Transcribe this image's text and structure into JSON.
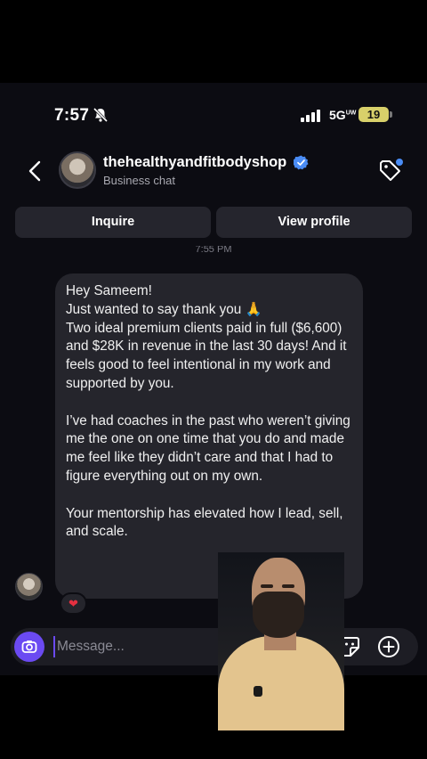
{
  "status_bar": {
    "time": "7:57",
    "network": "5G",
    "network_sup": "UW",
    "battery": "19"
  },
  "header": {
    "username": "thehealthyandfitbodyshop",
    "subtitle": "Business chat"
  },
  "actions": {
    "inquire": "Inquire",
    "view_profile": "View profile"
  },
  "thread": {
    "timestamp": "7:55 PM",
    "message": {
      "paragraphs": [
        "Hey Sameem!\nJust wanted to say thank you 🙏\nTwo ideal premium clients paid in full ($6,600) and $28K in revenue in the last 30 days! And it feels good to feel intentional in my work and supported by you.",
        "I’ve had coaches in the past who weren’t giving me the one on one time that you do and made me feel like they didn’t care and that I had to figure everything out on my own.",
        "Your mentorship has elevated how I lead, sell, and scale."
      ],
      "reaction": "❤"
    }
  },
  "composer": {
    "placeholder": "Message..."
  },
  "colors": {
    "accent": "#6b4af2",
    "verified": "#4a8cf5",
    "bubble": "#25252c",
    "background": "#0c0c12"
  },
  "icons": [
    "back-chevron-icon",
    "verified-badge-icon",
    "tag-icon",
    "camera-icon",
    "sticker-icon",
    "plus-circle-icon",
    "muted-bell-icon",
    "signal-icon"
  ]
}
